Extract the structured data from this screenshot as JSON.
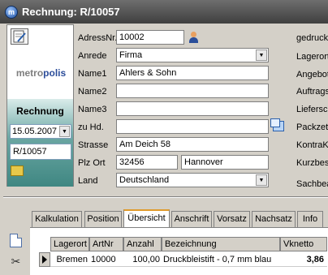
{
  "window": {
    "title": "Rechnung: R/10057"
  },
  "left_panel": {
    "logo_part1": "metro",
    "logo_part2": "polis",
    "doc_type": "Rechnung",
    "date_value": "15.05.2007",
    "doc_number": "R/10057"
  },
  "form": {
    "adressnr_label": "AdressNr.",
    "adressnr_value": "10002",
    "anrede_label": "Anrede",
    "anrede_value": "Firma",
    "name1_label": "Name1",
    "name1_value": "Ahlers & Sohn",
    "name2_label": "Name2",
    "name2_value": "",
    "name3_label": "Name3",
    "name3_value": "",
    "zuhd_label": "zu Hd.",
    "zuhd_value": "",
    "strasse_label": "Strasse",
    "strasse_value": "Am Deich 58",
    "plzort_label": "Plz  Ort",
    "plz_value": "32456",
    "ort_value": "Hannover",
    "land_label": "Land",
    "land_value": "Deutschland"
  },
  "right_labels": [
    "gedruckt",
    "Lagerort",
    "Angebot",
    "Auftrags",
    "Liefersch",
    "Packzet",
    "KontraK",
    "Kurzbes",
    "Sachbea"
  ],
  "tabs": [
    {
      "label": "Kalkulation",
      "active": false
    },
    {
      "label": "Position",
      "active": false
    },
    {
      "label": "Übersicht",
      "active": true
    },
    {
      "label": "Anschrift",
      "active": false
    },
    {
      "label": "Vorsatz",
      "active": false
    },
    {
      "label": "Nachsatz",
      "active": false
    },
    {
      "label": "Info",
      "active": false
    }
  ],
  "grid": {
    "headers": [
      "Lagerort",
      "ArtNr",
      "Anzahl",
      "Bezeichnung",
      "Vknetto"
    ],
    "rows": [
      [
        "Bremen",
        "10000",
        "100,00",
        "Druckbleistift - 0,7 mm  blau",
        "3,86"
      ]
    ]
  },
  "icons": {
    "app": "metropolis-app-icon",
    "edit": "edit-document-icon",
    "folder": "folder-icon",
    "person": "person-lookup-icon",
    "windows": "windows-icon",
    "new_doc": "new-document-icon",
    "scissors": "scissors-icon"
  },
  "colors": {
    "titlebar": "#4a4a4a",
    "teal_panel": "#4f9590",
    "logo_blue": "#2c4d9a",
    "active_tab_accent": "#e09a2a"
  }
}
